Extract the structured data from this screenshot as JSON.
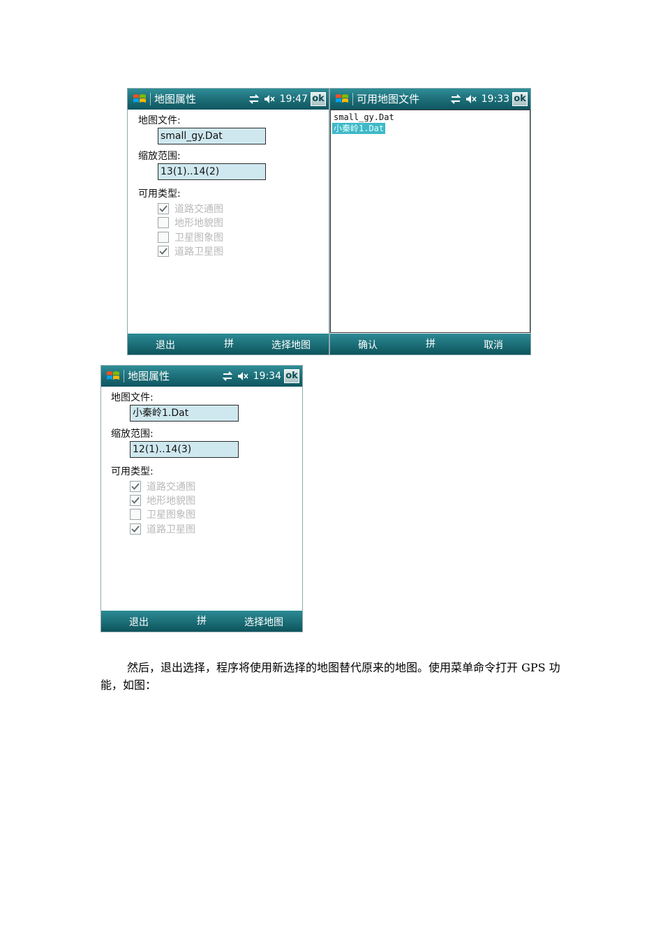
{
  "screens": [
    {
      "title": "地图属性",
      "time": "19:47",
      "ok_label": "ok",
      "map_file_label": "地图文件:",
      "map_file_value": "small_gy.Dat",
      "zoom_label": "缩放范围:",
      "zoom_value": "13(1)..14(2)",
      "types_label": "可用类型:",
      "types": [
        {
          "label": "道路交通图",
          "checked": true
        },
        {
          "label": "地形地貌图",
          "checked": false
        },
        {
          "label": "卫星图象图",
          "checked": false
        },
        {
          "label": "道路卫星图",
          "checked": true
        }
      ],
      "softkeys": {
        "left": "退出",
        "center": "拼",
        "right": "选择地图"
      }
    },
    {
      "title": "可用地图文件",
      "time": "19:33",
      "ok_label": "ok",
      "files": [
        "small_gy.Dat",
        "小秦岭1.Dat"
      ],
      "selected_index": 1,
      "softkeys": {
        "left": "确认",
        "center": "拼",
        "right": "取消"
      }
    },
    {
      "title": "地图属性",
      "time": "19:34",
      "ok_label": "ok",
      "map_file_label": "地图文件:",
      "map_file_value": "小秦岭1.Dat",
      "zoom_label": "缩放范围:",
      "zoom_value": "12(1)..14(3)",
      "types_label": "可用类型:",
      "types": [
        {
          "label": "道路交通图",
          "checked": true
        },
        {
          "label": "地形地貌图",
          "checked": true
        },
        {
          "label": "卫星图象图",
          "checked": false
        },
        {
          "label": "道路卫星图",
          "checked": true
        }
      ],
      "softkeys": {
        "left": "退出",
        "center": "拼",
        "right": "选择地图"
      }
    }
  ],
  "caption": "然后，退出选择，程序将使用新选择的地图替代原来的地图。使用菜单命令打开 GPS 功能，如图：",
  "colors": {
    "titlebar": "#1d6f78",
    "field_bg": "#cfe8ef",
    "selection": "#3fb9c8"
  }
}
